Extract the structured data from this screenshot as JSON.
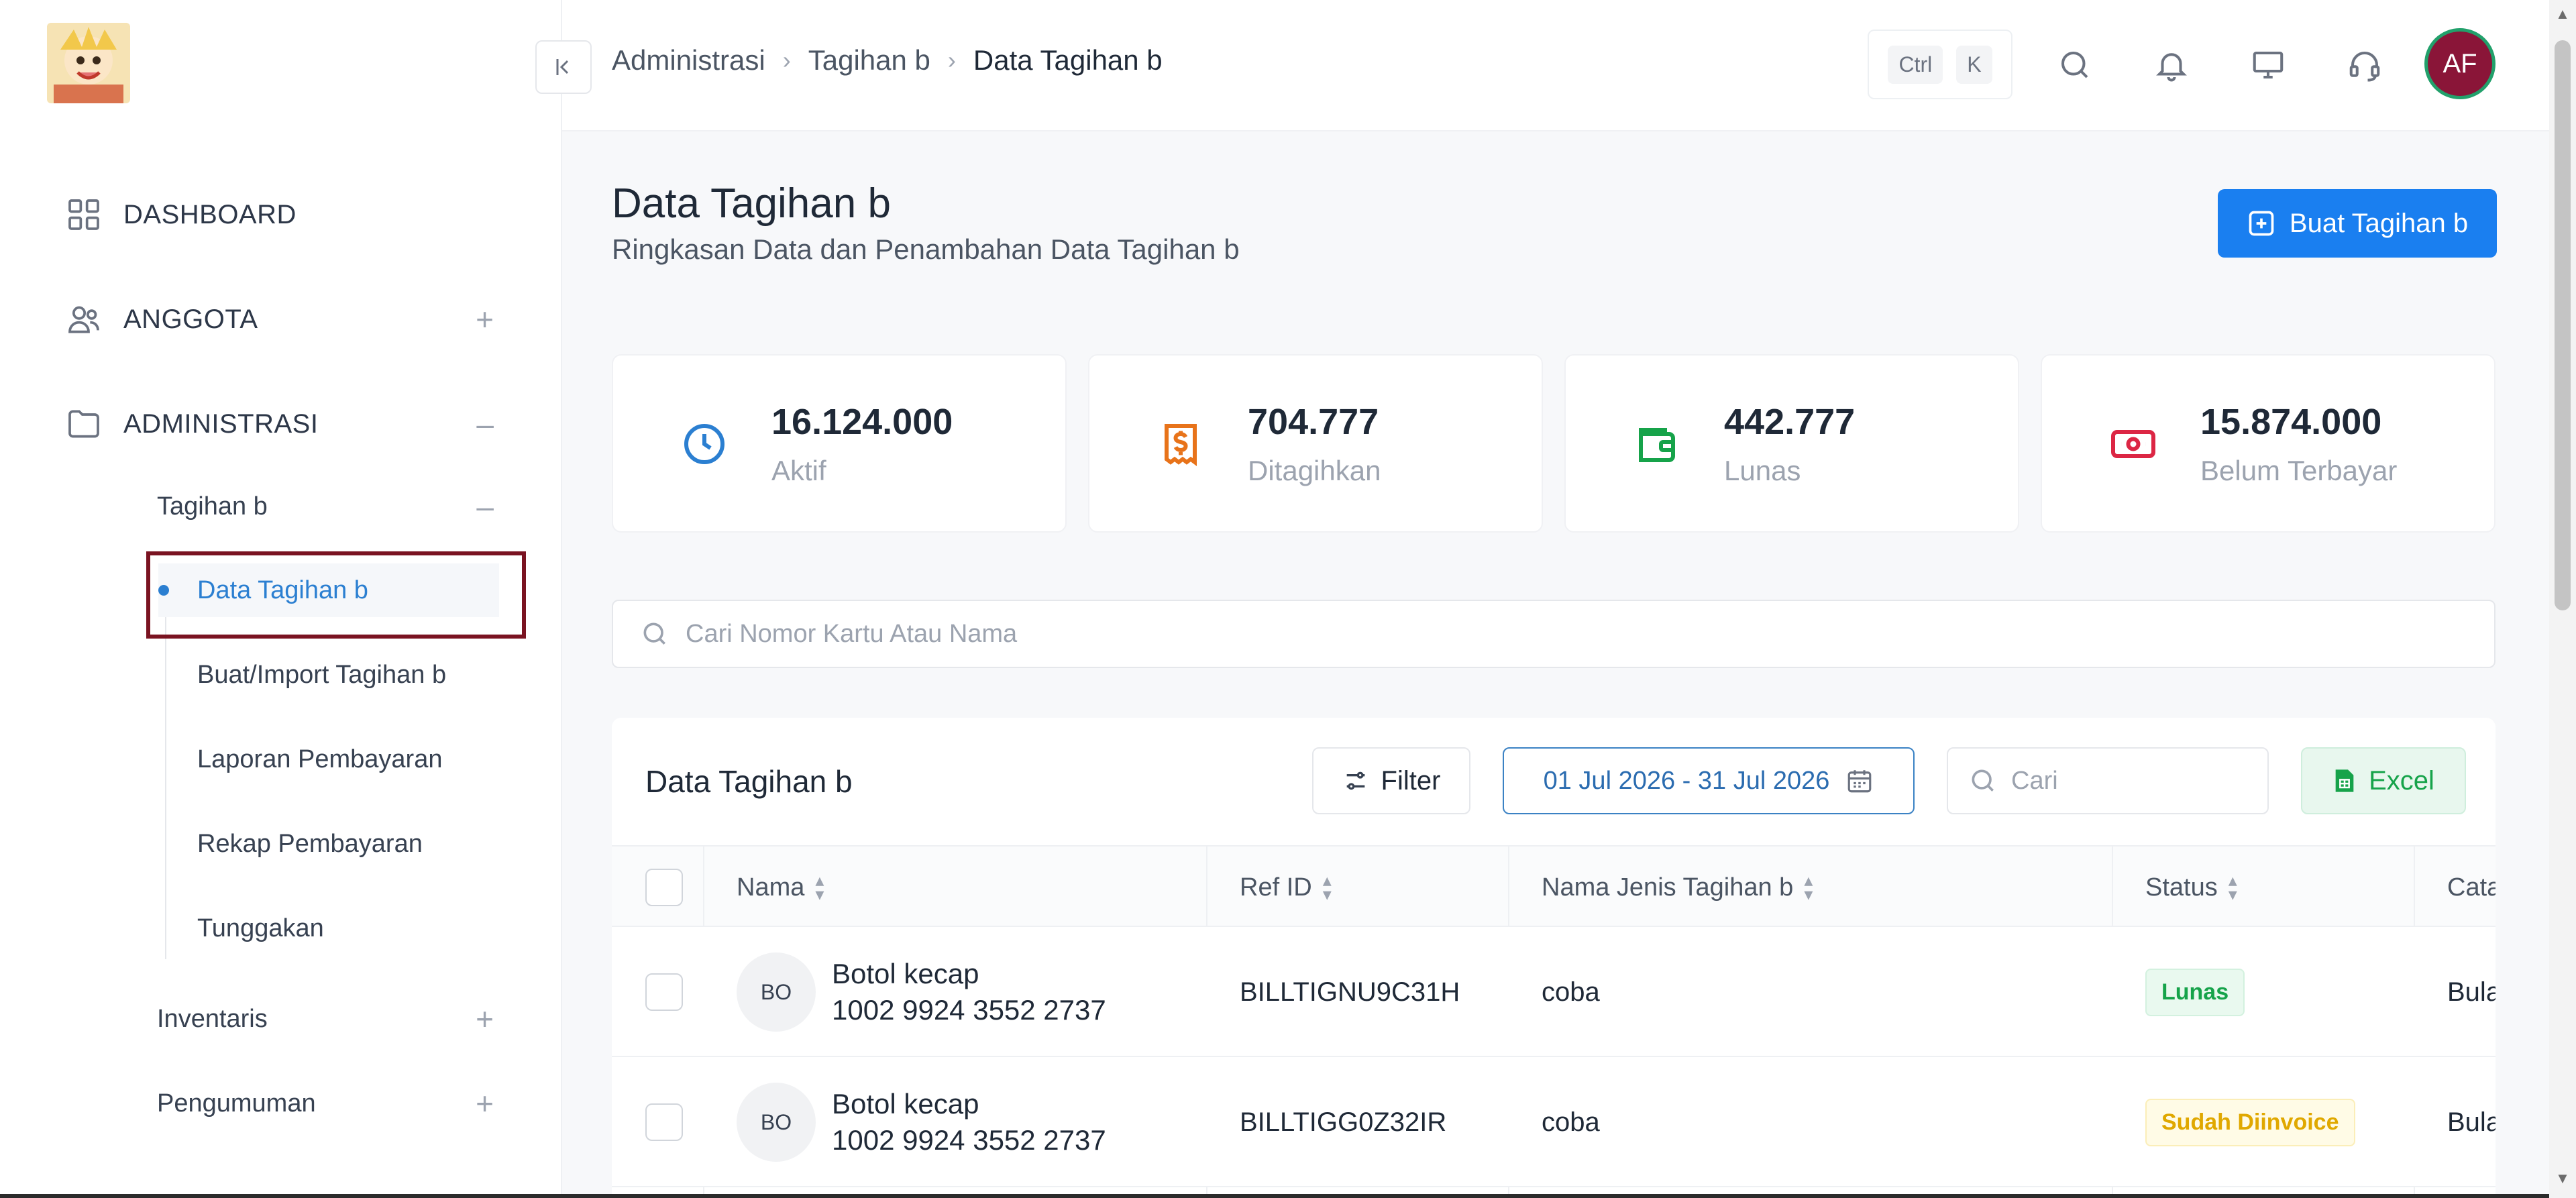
{
  "topbar": {
    "breadcrumbs": [
      "Administrasi",
      "Tagihan b",
      "Data Tagihan b"
    ],
    "shortcut_keys": [
      "Ctrl",
      "K"
    ],
    "avatar_initials": "AF"
  },
  "sidebar": {
    "main_items": [
      {
        "label": "DASHBOARD",
        "icon": "grid-icon"
      },
      {
        "label": "ANGGOTA",
        "icon": "users-icon",
        "toggle": "+"
      },
      {
        "label": "ADMINISTRASI",
        "icon": "folder-icon",
        "toggle": "–"
      }
    ],
    "sub_groups": [
      {
        "label": "Tagihan b",
        "toggle": "–"
      },
      {
        "label": "Inventaris",
        "toggle": "+"
      },
      {
        "label": "Pengumuman",
        "toggle": "+"
      }
    ],
    "leaves": [
      "Data Tagihan b",
      "Buat/Import Tagihan b",
      "Laporan Pembayaran",
      "Rekap Pembayaran",
      "Tunggakan"
    ]
  },
  "page": {
    "title": "Data Tagihan b",
    "subtitle": "Ringkasan Data dan Penambahan Data Tagihan b",
    "create_button": "Buat Tagihan b"
  },
  "stats": [
    {
      "value": "16.124.000",
      "label": "Aktif",
      "icon": "clock-icon",
      "color": "#2b7fd1"
    },
    {
      "value": "704.777",
      "label": "Ditagihkan",
      "icon": "invoice-dollar-icon",
      "color": "#e8731a"
    },
    {
      "value": "442.777",
      "label": "Lunas",
      "icon": "wallet-icon",
      "color": "#16a34a"
    },
    {
      "value": "15.874.000",
      "label": "Belum Terbayar",
      "icon": "cash-icon",
      "color": "#dc2644"
    }
  ],
  "search": {
    "placeholder": "Cari Nomor Kartu Atau Nama"
  },
  "table": {
    "title": "Data Tagihan b",
    "filter_label": "Filter",
    "date_range": "01 Jul 2026 - 31 Jul 2026",
    "search_placeholder": "Cari",
    "excel_label": "Excel",
    "columns": [
      "Nama",
      "Ref ID",
      "Nama Jenis Tagihan b",
      "Status",
      "Cata"
    ],
    "rows": [
      {
        "initials": "BO",
        "name": "Botol kecap",
        "card": "1002 9924 3552 2737",
        "ref": "BILLTIGNU9C31H",
        "jenis": "coba",
        "status": "Lunas",
        "catatan": "Bula"
      },
      {
        "initials": "BO",
        "name": "Botol kecap",
        "card": "1002 9924 3552 2737",
        "ref": "BILLTIGG0Z32IR",
        "jenis": "coba",
        "status": "Sudah Diinvoice",
        "catatan": "Bula"
      }
    ]
  }
}
